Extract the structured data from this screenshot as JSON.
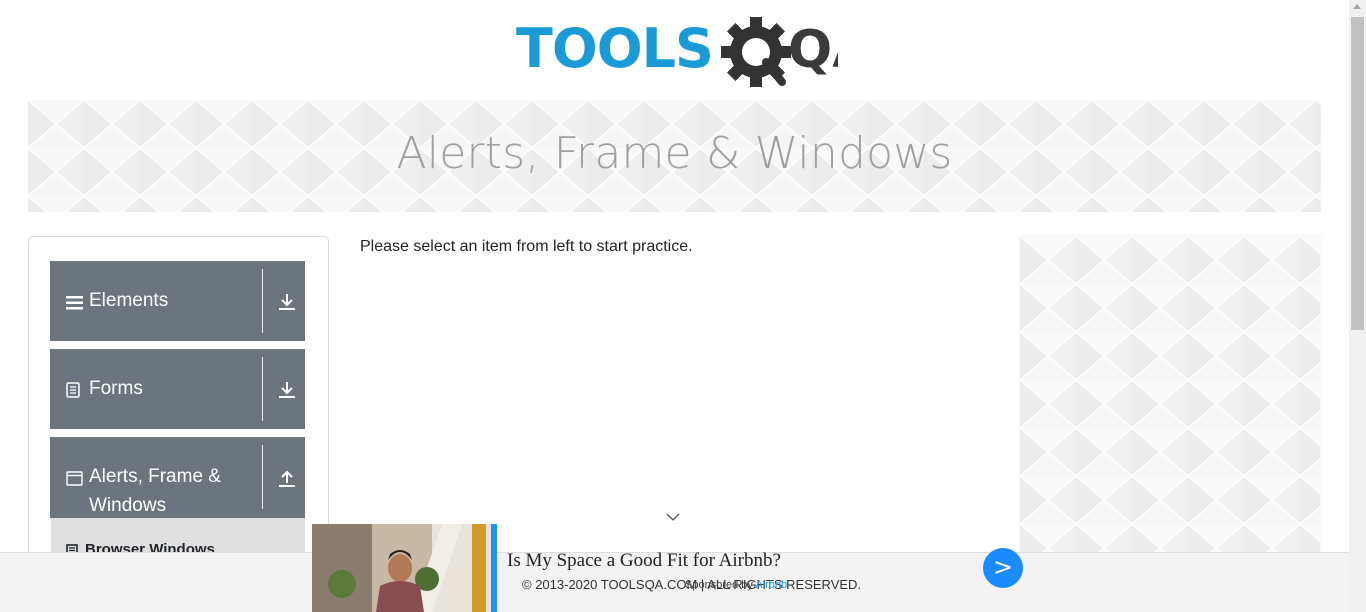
{
  "logo": {
    "text_primary": "TOOLS",
    "text_secondary": "QA",
    "color_primary": "#1a9ad6",
    "color_secondary": "#3a3a3a"
  },
  "banner": {
    "title": "Alerts, Frame & Windows"
  },
  "sidebar": {
    "groups": [
      {
        "label": "Elements",
        "icon": "hamburger-icon",
        "toggle": "download-icon"
      },
      {
        "label": "Forms",
        "icon": "document-icon",
        "toggle": "download-icon"
      },
      {
        "label": "Alerts, Frame &",
        "label2": "Windows",
        "icon": "window-icon",
        "toggle": "upload-icon"
      }
    ],
    "active_item": {
      "label": "Browser Windows",
      "icon": "browser-icon"
    }
  },
  "main": {
    "instruction": "Please select an item from left to start practice."
  },
  "footer": {
    "copyright": "© 2013-2020 TOOLSQA.COM | ALL RIGHTS RESERVED."
  },
  "ad": {
    "headline": "Is My Space a Good Fit for Airbnb?",
    "sponsored_prefix": "Sponsored by",
    "sponsor_brand": "Airbnb",
    "button_label": ">"
  },
  "colors": {
    "sidebar_group_bg": "#6c757d",
    "accent_blue": "#1a8cff",
    "banner_text": "#a0a0a0"
  }
}
